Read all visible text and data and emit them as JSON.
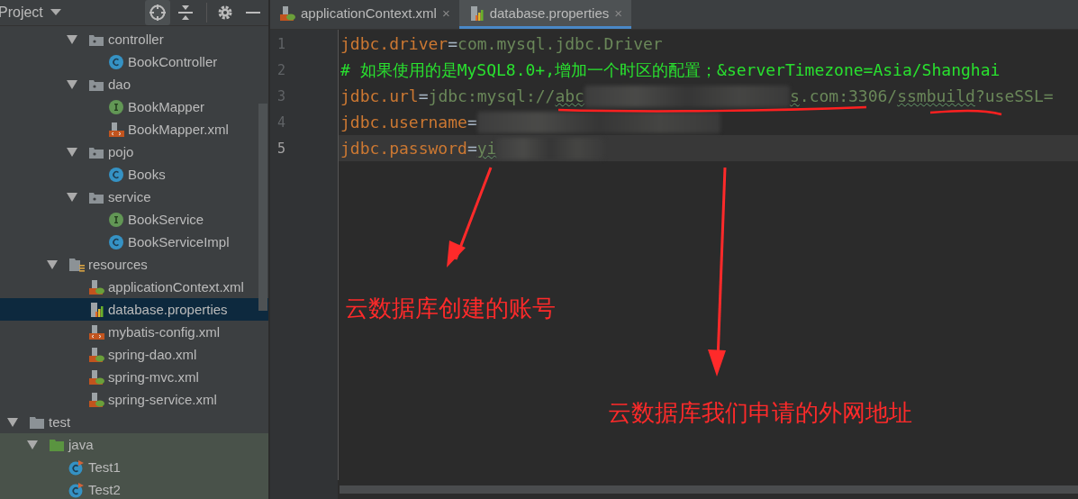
{
  "project_panel": {
    "title": "Project",
    "tree": [
      {
        "children": [
          {
            "children": [
              {
                "children": [
                  {
                    "label": "controller",
                    "kind": "package",
                    "expanded": true,
                    "selected": false,
                    "children": [
                      {
                        "label": "BookController",
                        "kind": "class",
                        "selected": false
                      }
                    ]
                  },
                  {
                    "label": "dao",
                    "kind": "package",
                    "expanded": true,
                    "selected": false,
                    "children": [
                      {
                        "label": "BookMapper",
                        "kind": "interface",
                        "selected": false
                      },
                      {
                        "label": "BookMapper.xml",
                        "kind": "xml",
                        "selected": false
                      }
                    ]
                  },
                  {
                    "label": "pojo",
                    "kind": "package",
                    "expanded": true,
                    "selected": false,
                    "children": [
                      {
                        "label": "Books",
                        "kind": "class",
                        "selected": false
                      }
                    ]
                  },
                  {
                    "label": "service",
                    "kind": "package",
                    "expanded": true,
                    "selected": false,
                    "children": [
                      {
                        "label": "BookService",
                        "kind": "interface",
                        "selected": false
                      },
                      {
                        "label": "BookServiceImpl",
                        "kind": "class",
                        "selected": false
                      }
                    ]
                  }
                ]
              },
              {
                "label": "resources",
                "kind": "resources",
                "expanded": true,
                "selected": false,
                "children": [
                  {
                    "label": "applicationContext.xml",
                    "kind": "spring-xml",
                    "selected": false
                  },
                  {
                    "label": "database.properties",
                    "kind": "properties",
                    "selected": true
                  },
                  {
                    "label": "mybatis-config.xml",
                    "kind": "xml",
                    "selected": false
                  },
                  {
                    "label": "spring-dao.xml",
                    "kind": "spring-xml",
                    "selected": false
                  },
                  {
                    "label": "spring-mvc.xml",
                    "kind": "spring-xml",
                    "selected": false
                  },
                  {
                    "label": "spring-service.xml",
                    "kind": "spring-xml",
                    "selected": false
                  }
                ]
              }
            ]
          }
        ]
      },
      {
        "label": "test",
        "kind": "folder",
        "expanded": true,
        "selected": false,
        "children": [
          {
            "label": "java",
            "kind": "test-source",
            "expanded": true,
            "selected": false,
            "children": [
              {
                "label": "Test1",
                "kind": "test-class",
                "selected": false
              },
              {
                "label": "Test2",
                "kind": "test-class",
                "selected": false
              }
            ]
          }
        ]
      }
    ]
  },
  "tabs": [
    {
      "label": "applicationContext.xml",
      "kind": "spring-xml",
      "selected": false,
      "close": "×"
    },
    {
      "label": "database.properties",
      "kind": "properties",
      "selected": true,
      "close": "×"
    }
  ],
  "editor": {
    "lines": [
      {
        "number": "1",
        "current": false,
        "segments": [
          {
            "kind": "key",
            "text": "jdbc.driver"
          },
          {
            "kind": "op",
            "text": "="
          },
          {
            "kind": "value",
            "text": "com.mysql.jdbc.Driver"
          }
        ]
      },
      {
        "number": "2",
        "current": false,
        "segments": [
          {
            "kind": "comment",
            "text": "# 如果使用的是MySQL8.0+,增加一个时区的配置；&serverTimezone=Asia/Shanghai"
          }
        ]
      },
      {
        "number": "3",
        "current": false,
        "segments": [
          {
            "kind": "key",
            "text": "jdbc.url"
          },
          {
            "kind": "op",
            "text": "="
          },
          {
            "kind": "value",
            "text": "jdbc:mysql://"
          },
          {
            "kind": "value",
            "text": "abc",
            "typo": true
          },
          {
            "kind": "redacted"
          },
          {
            "kind": "value",
            "text": "s",
            "typo": true
          },
          {
            "kind": "value",
            "text": ".com:3306/"
          },
          {
            "kind": "value",
            "text": "ssmbuild",
            "typo": true
          },
          {
            "kind": "value",
            "text": "?useSSL="
          }
        ]
      },
      {
        "number": "4",
        "current": false,
        "segments": [
          {
            "kind": "key",
            "text": "jdbc.username"
          },
          {
            "kind": "op",
            "text": "="
          },
          {
            "kind": "redacted"
          }
        ]
      },
      {
        "number": "5",
        "current": true,
        "segments": [
          {
            "kind": "key",
            "text": "jdbc.password"
          },
          {
            "kind": "op",
            "text": "="
          },
          {
            "kind": "value",
            "text": "yi",
            "typo": true
          },
          {
            "kind": "redacted"
          }
        ]
      }
    ]
  },
  "annotations": [
    {
      "text": "云数据库创建的账号"
    },
    {
      "text": "云数据库我们申请的外网地址"
    }
  ]
}
